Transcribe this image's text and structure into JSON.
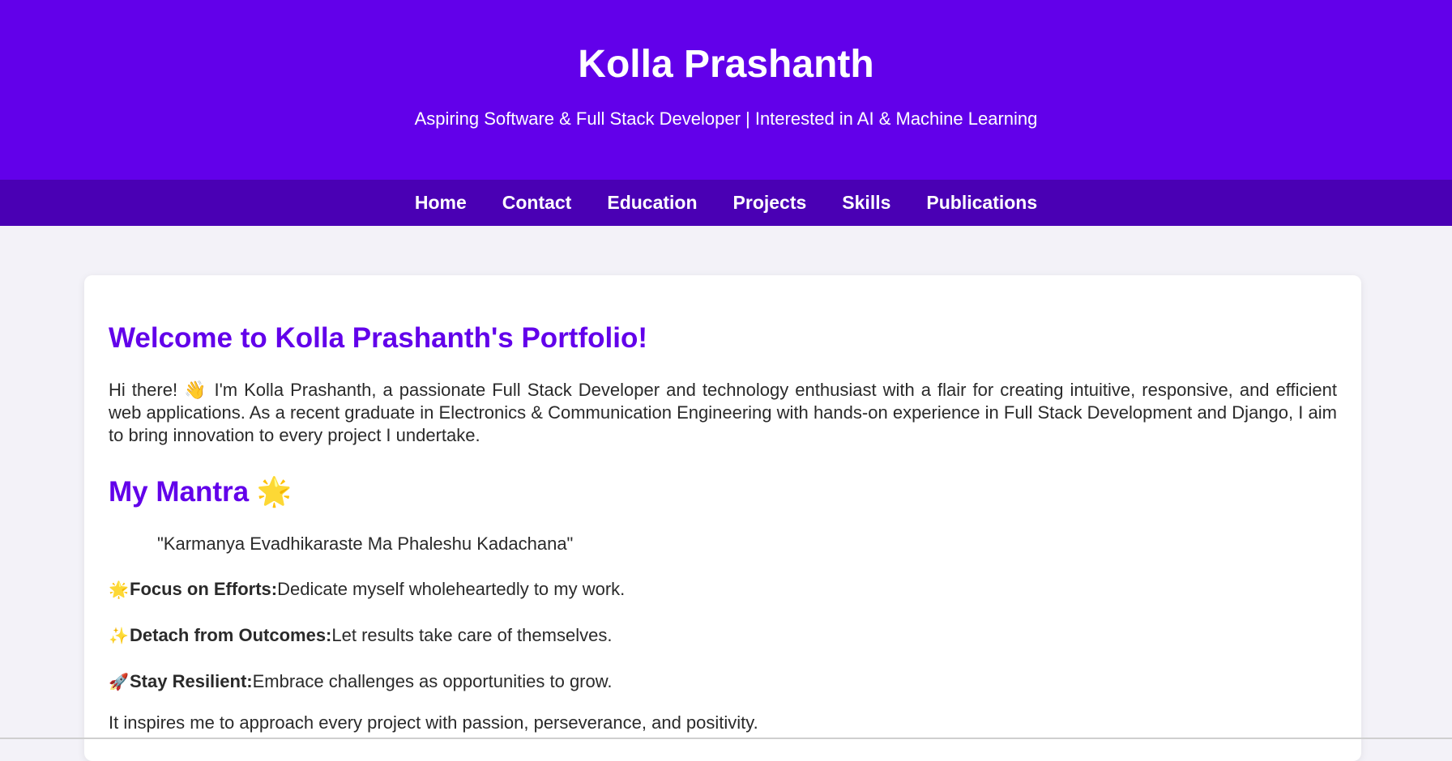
{
  "header": {
    "name": "Kolla Prashanth",
    "tagline": "Aspiring Software & Full Stack Developer | Interested in AI & Machine Learning"
  },
  "nav": {
    "items": [
      {
        "label": "Home"
      },
      {
        "label": "Contact"
      },
      {
        "label": "Education"
      },
      {
        "label": "Projects"
      },
      {
        "label": "Skills"
      },
      {
        "label": "Publications"
      }
    ]
  },
  "main": {
    "welcome_title": "Welcome to Kolla Prashanth's Portfolio!",
    "intro": "Hi there! 👋 I'm Kolla Prashanth, a passionate Full Stack Developer and technology enthusiast with a flair for creating intuitive, responsive, and efficient web applications. As a recent graduate in Electronics & Communication Engineering with hands-on experience in Full Stack Development and Django, I aim to bring innovation to every project I undertake.",
    "mantra_title": "My Mantra 🌟",
    "mantra_quote": "\"Karmanya Evadhikaraste Ma Phaleshu Kadachana\"",
    "principles": [
      {
        "emoji": "🌟",
        "title": "Focus on Efforts:",
        "text": "Dedicate myself wholeheartedly to my work."
      },
      {
        "emoji": "✨",
        "title": "Detach from Outcomes:",
        "text": "Let results take care of themselves."
      },
      {
        "emoji": "🚀",
        "title": "Stay Resilient:",
        "text": "Embrace challenges as opportunities to grow."
      }
    ],
    "closing": "It inspires me to approach every project with passion, perseverance, and positivity."
  },
  "colors": {
    "header_bg": "#6200ea",
    "nav_bg": "#4a00b4",
    "accent": "#6200ea",
    "page_bg": "#f3f2f8"
  }
}
